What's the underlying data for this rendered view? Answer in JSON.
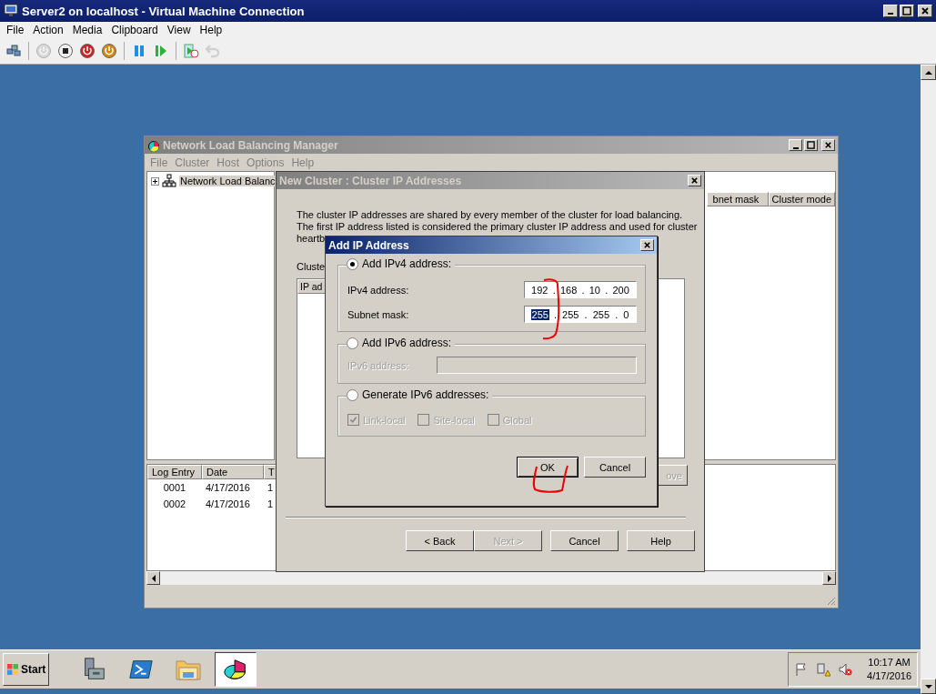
{
  "window": {
    "title": "Server2 on localhost - Virtual Machine Connection"
  },
  "menu": [
    "File",
    "Action",
    "Media",
    "Clipboard",
    "View",
    "Help"
  ],
  "toolbar": [
    {
      "kind": "ctrl-alt-del",
      "disabled": false
    },
    {
      "kind": "start",
      "disabled": true
    },
    {
      "kind": "turn-off",
      "disabled": false
    },
    {
      "kind": "shut-down",
      "disabled": false
    },
    {
      "kind": "save",
      "disabled": false
    },
    {
      "kind": "pause",
      "disabled": false
    },
    {
      "kind": "reset",
      "disabled": false
    },
    {
      "kind": "checkpoint",
      "disabled": false
    },
    {
      "kind": "revert",
      "disabled": true
    }
  ],
  "nlb_manager": {
    "title": "Network Load Balancing Manager",
    "menu": [
      "File",
      "Cluster",
      "Host",
      "Options",
      "Help"
    ],
    "tree": [
      {
        "label": "Network Load Balanc",
        "expanded": false
      }
    ],
    "columns": [
      "bnet mask",
      "Cluster mode"
    ],
    "log": {
      "columns": [
        "Log Entry",
        "Date",
        "T"
      ],
      "rows": [
        [
          "0001",
          "4/17/2016",
          "1"
        ],
        [
          "0002",
          "4/17/2016",
          "1"
        ]
      ]
    }
  },
  "new_cluster": {
    "title": "New Cluster :  Cluster IP Addresses",
    "intro_lines": [
      "The cluster IP addresses are shared by every member of the cluster for load balancing.",
      "The first IP address listed is considered the primary cluster IP address and used for cluster",
      "heartb"
    ],
    "list_label": "Cluste",
    "list_columns": [
      "IP ad"
    ],
    "side_button": {
      "label": "ove",
      "disabled": true
    },
    "buttons": [
      {
        "label": "< Back",
        "disabled": false
      },
      {
        "label": "Next >",
        "disabled": true
      },
      {
        "label": "Cancel",
        "disabled": false
      },
      {
        "label": "Help",
        "disabled": false
      }
    ]
  },
  "add_ip": {
    "title": "Add IP Address",
    "groups": [
      {
        "kind": "ipv4",
        "label": "Add IPv4 address:",
        "selected": true,
        "fields": [
          {
            "label": "IPv4 address:",
            "disabled": false,
            "separator": ".",
            "octets": [
              {
                "text": "192",
                "selected": false
              },
              {
                "text": "168",
                "selected": false
              },
              {
                "text": "10",
                "selected": false
              },
              {
                "text": "200",
                "selected": false
              }
            ]
          },
          {
            "label": "Subnet mask:",
            "disabled": false,
            "separator": ".",
            "octets": [
              {
                "text": "255",
                "selected": true
              },
              {
                "text": "255",
                "selected": false
              },
              {
                "text": "255",
                "selected": false
              },
              {
                "text": "0",
                "selected": false
              }
            ]
          }
        ]
      },
      {
        "kind": "ipv6",
        "label": "Add IPv6 address:",
        "selected": false,
        "fields": [
          {
            "label": "IPv6 address:",
            "disabled": true
          }
        ]
      },
      {
        "kind": "generate",
        "label": "Generate IPv6 addresses:",
        "selected": false,
        "checkboxes": [
          {
            "label": "Link-local",
            "checked": true,
            "disabled": true
          },
          {
            "label": "Site-local",
            "checked": false,
            "disabled": true
          },
          {
            "label": "Global",
            "checked": false,
            "disabled": true
          }
        ]
      }
    ],
    "buttons": [
      {
        "label": "OK",
        "default": true
      },
      {
        "label": "Cancel",
        "default": false
      }
    ]
  },
  "taskbar": {
    "start": "Start",
    "apps": [
      {
        "kind": "server-manager",
        "active": false
      },
      {
        "kind": "powershell",
        "active": false
      },
      {
        "kind": "explorer",
        "active": false
      },
      {
        "kind": "nlb",
        "active": true
      }
    ],
    "clock": {
      "time": "10:17 AM",
      "date": "4/17/2016"
    }
  }
}
